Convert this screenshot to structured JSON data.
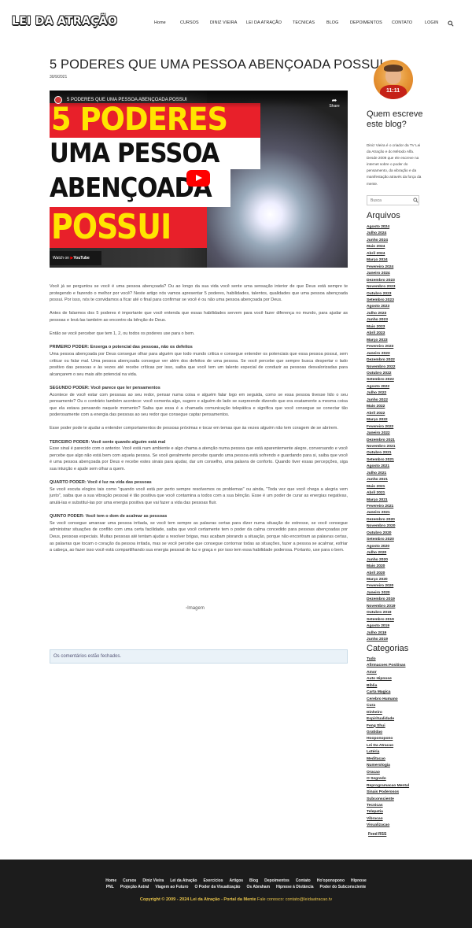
{
  "header": {
    "logo": "LEI DA ATRAÇÃO",
    "nav": [
      "Home",
      "CURSOS",
      "DINIZ VIEIRA",
      "LEI DA ATRAÇÃO",
      "TECNICAS",
      "BLOG",
      "DEPOIMENTOS",
      "CONTATO",
      "LOGIN"
    ]
  },
  "article": {
    "title": "5 PODERES QUE UMA PESSOA ABENÇOADA POSSUI",
    "date": "30/9/2021",
    "video": {
      "title": "5 PODERES QUE UMA PESSOA ABENÇOADA POSSUI",
      "share": "Share",
      "line1": "5 PODERES",
      "line2": "UMA PESSOA",
      "line3": "ABENÇOADA",
      "line4": "POSSUI",
      "watch_on": "Watch on",
      "youtube": "YouTube"
    },
    "paragraphs": [
      {
        "type": "p",
        "text": "Você já se perguntou se você é uma pessoa abençoada? Ou ao longo da sua vida você sente uma sensação interior de que Deus está sempre te protegendo e fazendo o melhor por você? Neste artigo nós vamos apresentar 5 poderes, habilidades, talentos, qualidades que uma pessoa abençoada possui. Por isso, nós te convidamos a ficar até o final para confirmar se você é ou não uma pessoa abençoada por Deus."
      },
      {
        "type": "p",
        "text": "Antes de falarmos dos 5 poderes é importante que você entenda que essas habilidades servem para você fazer diferença no mundo, para ajudar as pessoas e levá-las também ao encontro da bênção de Deus."
      },
      {
        "type": "p",
        "text": "Então se você perceber que tem 1, 2, ou todos os poderes use para o bem."
      },
      {
        "type": "h",
        "text": "PRIMEIRO PODER: Enxerga o potencial das pessoas, não os defeitos"
      },
      {
        "type": "p",
        "text": "Uma pessoa abençoada por Deus consegue olhar para alguém que todo mundo critica e consegue entender os potenciais que essa pessoa possui, sem criticar ou falar mal. Uma pessoa abençoada consegue ver além dos defeitos de uma pessoa. Se você percebe que sempre busca despertar o lado positivo das pessoas e às vezes até recebe críticas por isso, saiba que você tem um talento especial de conduzir as pessoas desvalorizadas para alcançarem o seu mais alto potencial na vida."
      },
      {
        "type": "h",
        "text": "SEGUNDO PODER: Você parece que ler pensamentos"
      },
      {
        "type": "p",
        "text": "Acontece de você estar com pessoas ao seu redor, pensar numa coisa e alguém falar logo em seguida, como se essa pessoa tivesse lido o seu pensamento? Ou o contrário também acontece: você comenta algo, sugere e alguém do lado se surpreende dizendo que era exatamente a mesma coisa que ela estava pensando naquele momento? Saiba que essa é a chamada comunicação telepática e significa que você consegue se conectar tão poderosamente com a energia das pessoas ao seu redor que consegue captar pensamentos."
      },
      {
        "type": "p",
        "text": "Esse poder pode te ajudar a entender comportamentos de pessoas próximas e tocar em temas que às vezes alguém não tem coragem de se abrirem."
      },
      {
        "type": "h",
        "text": "TERCEIRO PODER: Você sente quando alguém está mal"
      },
      {
        "type": "p",
        "text": "Esse sinal é parecido com o anterior. Você está num ambiente e algo chama a atenção numa pessoa que está aparentemente alegre, conversando e você percebe que algo não está bem com aquela pessoa. Se você geralmente percebe quando uma pessoa está sofrendo e guardando para si, saiba que você é uma pessoa abençoada por Deus e recebe estes sinais para ajudar, dar um conselho, uma palavra de conforto. Quando tiver essas percepções, siga sua intuição e ajude sem olhar a quem."
      },
      {
        "type": "h",
        "text": "QUARTO PODER: Você é luz na vida das pessoas"
      },
      {
        "type": "p",
        "text": "Se você escuta elogios tais como \"quando você está por perto sempre resolvemos os problemas\" ou ainda, \"Toda vez que você chega a alegria vem junto\", saiba que a sua vibração pessoal é tão positiva que você contamina a todos com a sua bênção. Esse é um poder de curar as energias negativas, anulá-las e substituí-las por uma energia positiva que vai fazer a vida das pessoas fluir."
      },
      {
        "type": "h",
        "text": "QUINTO PODER: Você tem o dom de acalmar as pessoas"
      },
      {
        "type": "p",
        "text": "Se você consegue amansar uma pessoa irritada, se você tem sempre as palavras certas para dizer numa situação de estresse, se você consegue administrar situações de conflito com uma certa facilidade, saiba que você certamente tem o poder da calma concedido para pessoas abençoadas por Deus, pessoas especiais. Muitas pessoas até tentam ajudar a resolver brigas, mas acabam piorando a situação, porque não encontram as palavras certas, as palavras que tocam o coração da pessoa irritada, mas se você percebe que consegue contornar todas as situações, fazer a pessoa se acalmar, esfriar a cabeça, ao fazer isso você está compartilhando sua energia pessoal de luz e graça e por isso tem essa habilidade poderosa. Portanto, use para o bem."
      }
    ],
    "image_alt": "Imagem",
    "comments_closed": "Os comentários estão fechados."
  },
  "sidebar": {
    "avatar_badge": "11:11",
    "about_title": "Quem escreve este blog?",
    "about_text": "Diniz Vieira é o criador da TV Lei da Atração e do Método Alfa. Desde 2009 que ele escreve na internet sobre o poder do pensamento, da vibração e da manifestação através da força da mente.",
    "search_placeholder": "Busca",
    "archives_title": "Arquivos",
    "archives": [
      "Agosto 2024",
      "Julho 2024",
      "Junho 2024",
      "Maio 2024",
      "Abril 2024",
      "Março 2024",
      "Fevereiro 2024",
      "Janeiro 2024",
      "Dezembro 2023",
      "Novembro 2023",
      "Outubro 2023",
      "Setembro 2023",
      "Agosto 2023",
      "Julho 2023",
      "Junho 2023",
      "Maio 2023",
      "Abril 2023",
      "Março 2023",
      "Fevereiro 2023",
      "Janeiro 2023",
      "Dezembro 2022",
      "Novembro 2022",
      "Outubro 2022",
      "Setembro 2022",
      "Agosto 2022",
      "Julho 2022",
      "Junho 2022",
      "Maio 2022",
      "Abril 2022",
      "Março 2022",
      "Fevereiro 2022",
      "Janeiro 2022",
      "Dezembro 2021",
      "Novembro 2021",
      "Outubro 2021",
      "Setembro 2021",
      "Agosto 2021",
      "Julho 2021",
      "Junho 2021",
      "Maio 2021",
      "Abril 2021",
      "Março 2021",
      "Fevereiro 2021",
      "Janeiro 2021",
      "Dezembro 2020",
      "Novembro 2020",
      "Outubro 2020",
      "Setembro 2020",
      "Agosto 2020",
      "Julho 2020",
      "Junho 2020",
      "Maio 2020",
      "Abril 2020",
      "Março 2020",
      "Fevereiro 2020",
      "Janeiro 2020",
      "Dezembro 2019",
      "Novembro 2019",
      "Outubro 2019",
      "Setembro 2019",
      "Agosto 2019",
      "Julho 2019",
      "Junho 2019"
    ],
    "categories_title": "Categorias",
    "categories": [
      "Tudo",
      "Afirmacoes Positivas",
      "Amor",
      "Auto Hipnose",
      "Bíblia",
      "Carta Magica",
      "Cerebro Humano",
      "Cura",
      "Dinheiro",
      "Espiritualidade",
      "Feng Shui",
      "Gratidao",
      "Hooponopono",
      "Lei Da Atracao",
      "Lotéria",
      "Meditacao",
      "Numerologia",
      "Oracao",
      "O Segredo",
      "Reprogramacao Mental",
      "Sinais Poderosos",
      "Subconsciente",
      "Tecnicas",
      "Telepatia",
      "Vibracao",
      "Visualizacao"
    ],
    "feed": "Feed RSS"
  },
  "footer": {
    "row1": [
      "Home",
      "Cursos",
      "Diniz Vieira",
      "Lei da Atração",
      "Exercícios",
      "Artigos",
      "Blog",
      "Depoimentos",
      "Contato",
      "Ho'oponopono",
      "Hipnose"
    ],
    "row2": [
      "PNL",
      "Projeção Astral",
      "Viagem ao Futuro",
      "O Poder da Visualização",
      "Os Abraham",
      "Hipnose à Distância",
      "Poder do Subconsciente"
    ],
    "copyright": "Copyright © 2009 - 2024 Lei da Atração - Portal da Mente",
    "contact_label": "Fale conosco:",
    "contact_email": "contato@leidaatracao.tv"
  },
  "colors": {
    "accent_red": "#e8202a",
    "accent_yellow": "#ffe500",
    "footer_bg": "#1c1c1c",
    "footer_gold": "#e7c34a"
  }
}
